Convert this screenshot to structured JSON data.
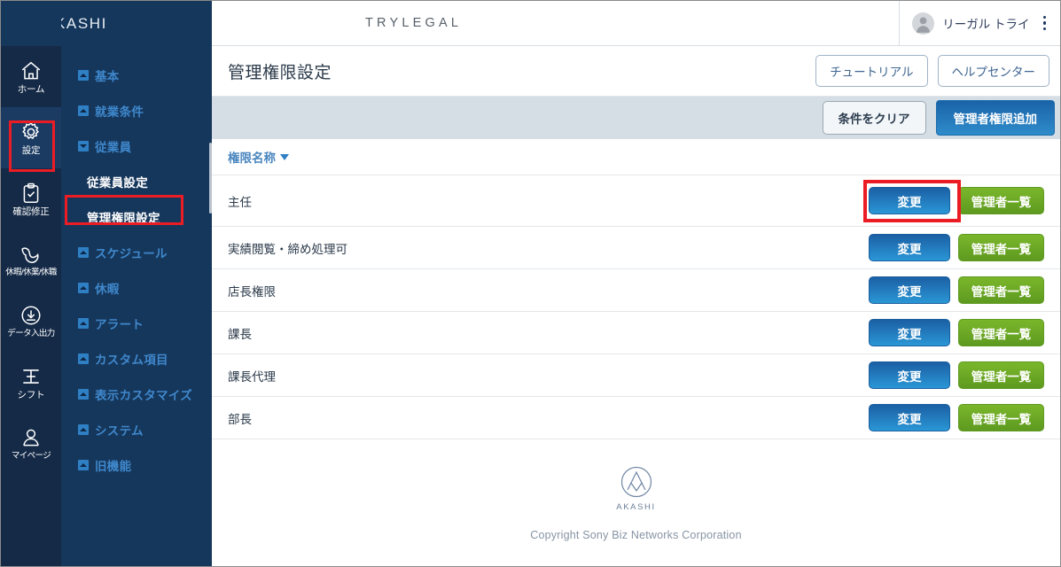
{
  "brand": {
    "name": "AKASHI",
    "mark_icon": "akashi-logo-icon"
  },
  "rail": {
    "items": [
      {
        "label": "ホーム",
        "icon": "home-icon",
        "active": false
      },
      {
        "label": "設定",
        "icon": "gear-icon",
        "active": true
      },
      {
        "label": "確認修正",
        "icon": "clipboard-check-icon",
        "active": false
      },
      {
        "label": "休暇/休業/休職",
        "icon": "bird-icon",
        "active": false
      },
      {
        "label": "データ入出力",
        "icon": "download-circle-icon",
        "active": false
      },
      {
        "label": "シフト",
        "icon": "shift-icon",
        "active": false
      },
      {
        "label": "マイページ",
        "icon": "person-icon",
        "active": false
      }
    ]
  },
  "submenu": {
    "items": [
      {
        "label": "基本",
        "state": "collapsed"
      },
      {
        "label": "就業条件",
        "state": "collapsed"
      },
      {
        "label": "従業員",
        "state": "expanded"
      },
      {
        "label": "スケジュール",
        "state": "collapsed"
      },
      {
        "label": "休暇",
        "state": "collapsed"
      },
      {
        "label": "アラート",
        "state": "collapsed"
      },
      {
        "label": "カスタム項目",
        "state": "collapsed"
      },
      {
        "label": "表示カスタマイズ",
        "state": "collapsed"
      },
      {
        "label": "システム",
        "state": "collapsed"
      },
      {
        "label": "旧機能",
        "state": "collapsed"
      }
    ],
    "children": [
      {
        "label": "従業員設定",
        "selected": false
      },
      {
        "label": "管理権限設定",
        "selected": true
      }
    ]
  },
  "topbar": {
    "tenant": "TRYLEGAL",
    "user_name": "リーガル トライ",
    "avatar_icon": "user-avatar-icon",
    "menu_icon": "kebab-menu-icon"
  },
  "page": {
    "title": "管理権限設定",
    "tutorial_label": "チュートリアル",
    "help_label": "ヘルプセンター"
  },
  "filterbar": {
    "clear_label": "条件をクリア",
    "add_label": "管理者権限追加"
  },
  "table": {
    "column_header": "権限名称",
    "sort_icon": "sort-descending-caret-icon",
    "edit_label": "変更",
    "admins_label": "管理者一覧",
    "rows": [
      {
        "name": "主任"
      },
      {
        "name": "実績閲覧・締め処理可"
      },
      {
        "name": "店長権限"
      },
      {
        "name": "課長"
      },
      {
        "name": "課長代理"
      },
      {
        "name": "部長"
      }
    ]
  },
  "footer": {
    "brand": "AKASHI",
    "copyright": "Copyright Sony Biz Networks Corporation"
  },
  "colors": {
    "rail_bg": "#152a47",
    "submenu_bg": "#16375c",
    "accent_blue": "#2f8ccb",
    "accent_green": "#7ab62b",
    "highlight_red": "#ec1c24",
    "filterbar_bg": "#d5dee5"
  }
}
